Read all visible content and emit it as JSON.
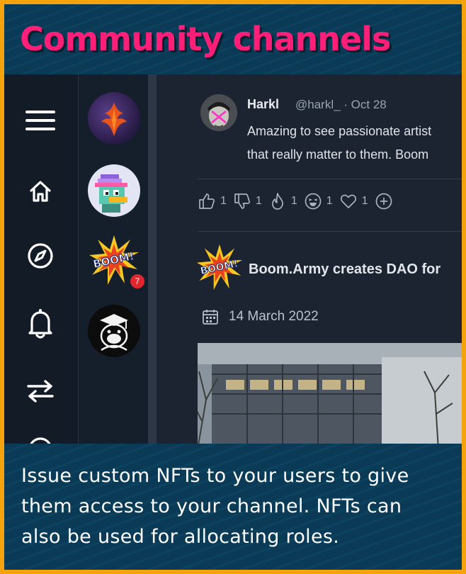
{
  "header": {
    "title": "Community channels"
  },
  "nav": {
    "items": [
      {
        "icon": "menu-icon"
      },
      {
        "icon": "home-icon"
      },
      {
        "icon": "compass-icon"
      },
      {
        "icon": "bell-icon"
      },
      {
        "icon": "swap-icon"
      }
    ]
  },
  "channels": {
    "items": [
      {
        "icon": "magic-logo"
      },
      {
        "icon": "pixel-bird-avatar"
      },
      {
        "icon": "boom-logo",
        "badge": "7"
      },
      {
        "icon": "gorilla-avatar"
      }
    ],
    "boom_text": "BOOM!"
  },
  "post": {
    "author": "Harkl",
    "handle": "@harkl_ · Oct 28",
    "text_line1": "Amazing to see passionate artist",
    "text_line2": "that really matter to them. Boom",
    "reactions": [
      {
        "icon": "thumbs-up-icon",
        "count": "1"
      },
      {
        "icon": "thumbs-down-icon",
        "count": "1"
      },
      {
        "icon": "fire-icon",
        "count": "1"
      },
      {
        "icon": "laugh-icon",
        "count": "1"
      },
      {
        "icon": "heart-icon",
        "count": "1"
      },
      {
        "icon": "add-reaction-icon"
      }
    ]
  },
  "post2": {
    "title": "Boom.Army creates DAO for",
    "date": "14 March 2022"
  },
  "footer": {
    "text": "Issue custom NFTs to your users to give them access to your channel. NFTs can also be used for allocating roles."
  },
  "colors": {
    "frame": "#f5a30c",
    "title": "#ff1f78",
    "panel": "#0b3550"
  }
}
